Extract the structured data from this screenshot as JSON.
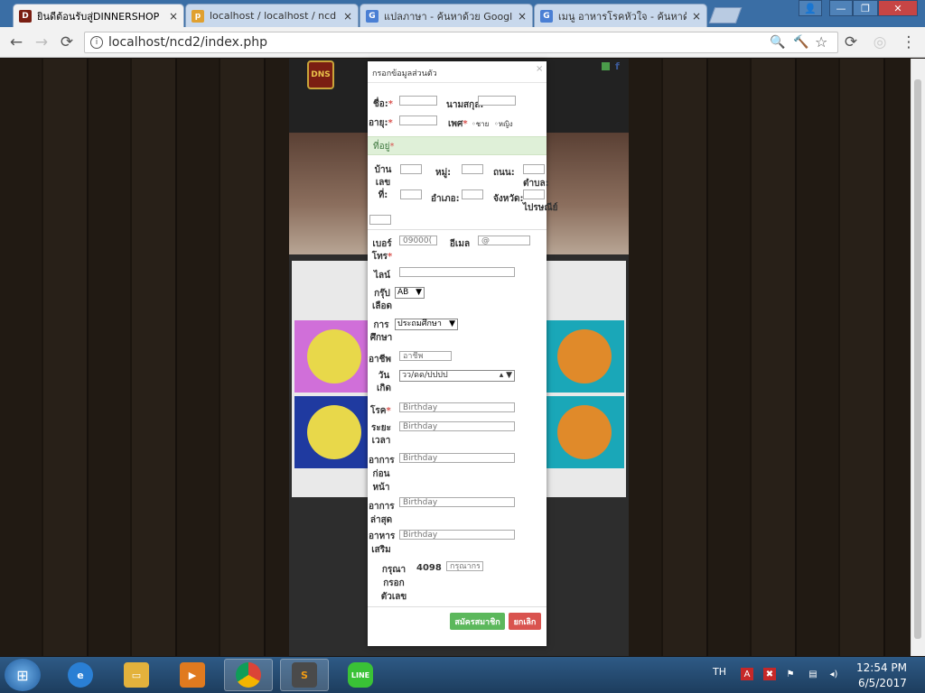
{
  "browser": {
    "tabs": [
      {
        "label": "ยินดีต้อนรับสู่DINNERSHOP",
        "icon": "restaurant-logo-icon",
        "active": true
      },
      {
        "label": "localhost / localhost / ncd",
        "icon": "phpmyadmin-icon",
        "active": false
      },
      {
        "label": "แปลภาษา - ค้นหาด้วย Google",
        "icon": "google-icon",
        "active": false
      },
      {
        "label": "เมนู อาหารโรคหัวใจ - ค้นหาด้วย",
        "icon": "google-icon",
        "active": false
      }
    ],
    "tab_close": "×",
    "window_controls": {
      "user": "👤",
      "minimize": "—",
      "maximize": "❐",
      "close": "✕"
    },
    "nav": {
      "back": "←",
      "forward": "→",
      "reload": "⟳",
      "info": "i"
    },
    "url": "localhost/ncd2/index.php",
    "omnibox_icons": {
      "zoom": "🔍",
      "tools": "🔨",
      "star": "☆"
    },
    "extension_icons": {
      "ext1": "⟳",
      "ext2": "◎",
      "menu": "⋮"
    }
  },
  "site": {
    "logo_text": "DNS",
    "social": [
      "f"
    ],
    "tiles": [
      {
        "name": "drink",
        "bg": "#d06fd9",
        "circle": "#e8d84a"
      },
      {
        "name": "cake",
        "bg": "#1aa7b8",
        "circle": "#e08a2a"
      },
      {
        "name": "promotion",
        "bg": "#1f3aa0",
        "circle": "#e8d84a"
      },
      {
        "name": "food",
        "bg": "#1aa7b8",
        "circle": "#e08a2a"
      }
    ]
  },
  "modal": {
    "title": "กรอกข้อมูลส่วนตัว",
    "close": "×",
    "fields": {
      "first_name": {
        "label": "ชื่อ:",
        "value": ""
      },
      "last_name": {
        "label": "นามสกุล:",
        "value": ""
      },
      "age": {
        "label": "อายุ:",
        "value": ""
      },
      "gender": {
        "label": "เพศ",
        "options": [
          "ชาย",
          "หญิง"
        ]
      },
      "address_header": "ที่อยู่",
      "house_no": {
        "label": "บ้านเลขที่:",
        "value": ""
      },
      "moo": {
        "label": "หมู่:",
        "value": ""
      },
      "road": {
        "label": "ถนน:",
        "value": ""
      },
      "subdistrict": {
        "label": "ตำบล:",
        "value": ""
      },
      "district": {
        "label": "อำเภอ:",
        "value": ""
      },
      "province": {
        "label": "จังหวัด:",
        "value": ""
      },
      "postcode": {
        "label": "ไปรษณีย์",
        "value": ""
      },
      "phone": {
        "label": "เบอร์โทร",
        "placeholder": "09000(",
        "value": ""
      },
      "email": {
        "label": "อีเมล",
        "placeholder": "@",
        "value": ""
      },
      "line": {
        "label": "ไลน์",
        "value": ""
      },
      "blood": {
        "label": "กรุ๊ปเลือด",
        "selected": "AB"
      },
      "education": {
        "label": "การศึกษา",
        "selected": "ประถมศึกษา"
      },
      "occupation": {
        "label": "อาชีพ",
        "placeholder": "อาชีพ",
        "value": ""
      },
      "birthdate": {
        "label": "วันเกิด",
        "placeholder": "วว/ดด/ปปปป"
      },
      "disease": {
        "label": "โรค",
        "placeholder": "Birthday",
        "value": ""
      },
      "duration": {
        "label": "ระยะเวลา",
        "placeholder": "Birthday",
        "value": ""
      },
      "prev_symptom": {
        "label": "อาการก่อนหน้า",
        "placeholder": "Birthday",
        "value": ""
      },
      "recent_symptom": {
        "label": "อาการล่าสุด",
        "placeholder": "Birthday",
        "value": ""
      },
      "supplement": {
        "label": "อาหารเสริม",
        "placeholder": "Birthday",
        "value": ""
      },
      "captcha": {
        "label": "กรุณากรอกตัวเลข",
        "code": "4098",
        "placeholder": "กรุณากร",
        "value": ""
      }
    },
    "required_mark": "*",
    "buttons": {
      "register": "สมัครสมาชิก",
      "cancel": "ยกเลิก"
    }
  },
  "taskbar": {
    "start": "⊞",
    "apps": [
      {
        "name": "internet-explorer",
        "glyph": "e",
        "color": "#2a7fd4",
        "open": false
      },
      {
        "name": "file-explorer",
        "glyph": "▭",
        "color": "#e3b23c",
        "open": false
      },
      {
        "name": "media-player",
        "glyph": "▶",
        "color": "#e07a1f",
        "open": false
      },
      {
        "name": "chrome",
        "glyph": "◉",
        "color": "#3a9a4a",
        "open": true
      },
      {
        "name": "sublime-text",
        "glyph": "S",
        "color": "#4a4a4a",
        "open": true
      },
      {
        "name": "line",
        "glyph": "LINE",
        "color": "#3ac236",
        "open": false
      }
    ],
    "language": "TH",
    "tray_icons": [
      "A",
      "✖",
      "⚑",
      "▤",
      "◂)"
    ],
    "time": "12:54 PM",
    "date": "6/5/2017"
  }
}
